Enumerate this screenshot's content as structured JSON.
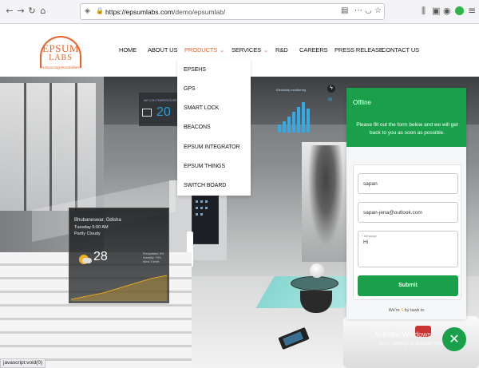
{
  "browser": {
    "url_domain": "https://epsumlabs.com",
    "url_path": "/demo/epsumlab/",
    "status_text": "javascript:void(0)"
  },
  "site": {
    "logo": {
      "line1": "EPSUM",
      "line2": "LABS",
      "tagline": "Outsourcing Possibilities..."
    },
    "menu": [
      {
        "label": "HOME"
      },
      {
        "label": "ABOUT US"
      },
      {
        "label": "PRODUCTS",
        "caret": "⌄",
        "active": true
      },
      {
        "label": "SERVICES",
        "caret": "⌄"
      },
      {
        "label": "R&D"
      },
      {
        "label": "CAREERS"
      },
      {
        "label": "PRESS RELEASE"
      },
      {
        "label": "CONTACT US"
      }
    ],
    "products_dropdown": [
      "EPSEHS",
      "GPS",
      "SMART LOCK",
      "BEACONS",
      "EPSUM INTEGRATOR",
      "EPSUM THINGS",
      "SWITCH BOARD"
    ]
  },
  "hero": {
    "temp_label": "AIR CON TEMPERATURE",
    "temp_value": "20",
    "weather": {
      "city": "Bhubaneswar, Odisha",
      "day_time": "Tuesday 5:00 AM",
      "condition": "Partly Cloudy",
      "temperature": "28",
      "mini_lines": [
        "Precipitation: 6%",
        "Humidity: 79%",
        "Wind: 5 km/h"
      ]
    },
    "energy_title": "Electricity monitoring"
  },
  "chat": {
    "status": "Offline",
    "message": "Please fill out the form below and we will get back to you as soon as possible.",
    "name_value": "sapan",
    "email_value": "sapan-jena@outlook.com",
    "message_label": "* Message",
    "message_value": "Hi",
    "submit_label": "Submit",
    "footer_prefix": "We're",
    "footer_suffix": "by tawk.to",
    "close_icon": "✕",
    "brand_color": "#1aa04a"
  },
  "os_watermark": {
    "line1": "Activate Windows",
    "line2": "Go to Settings to activate Windows."
  }
}
